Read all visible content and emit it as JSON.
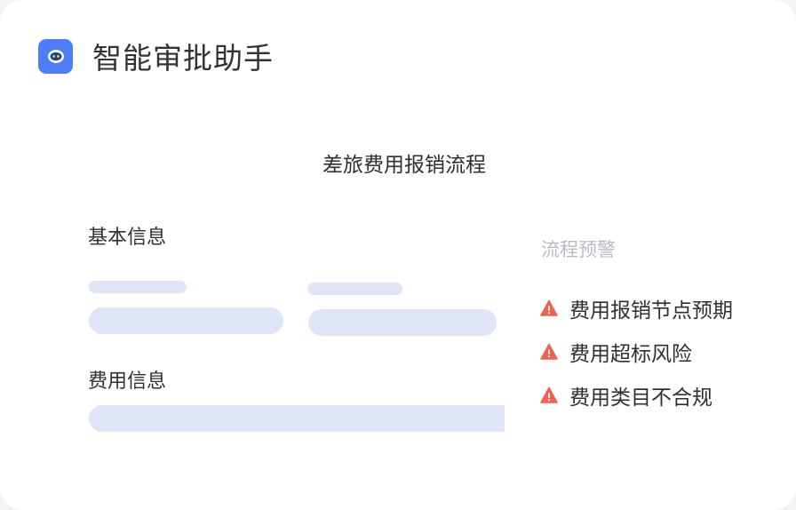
{
  "app": {
    "title": "智能审批助手",
    "icon": "robot-icon",
    "accent": "#4c7dfa"
  },
  "flow": {
    "title": "差旅费用报销流程"
  },
  "form": {
    "basic_label": "基本信息",
    "cost_label": "费用信息",
    "placeholder_color": "#dfe5f7"
  },
  "alerts": {
    "title": "流程预警",
    "icon": "warning-icon",
    "color": "#f2604b",
    "items": [
      {
        "label": "费用报销节点预期"
      },
      {
        "label": "费用超标风险"
      },
      {
        "label": "费用类目不合规"
      }
    ]
  }
}
